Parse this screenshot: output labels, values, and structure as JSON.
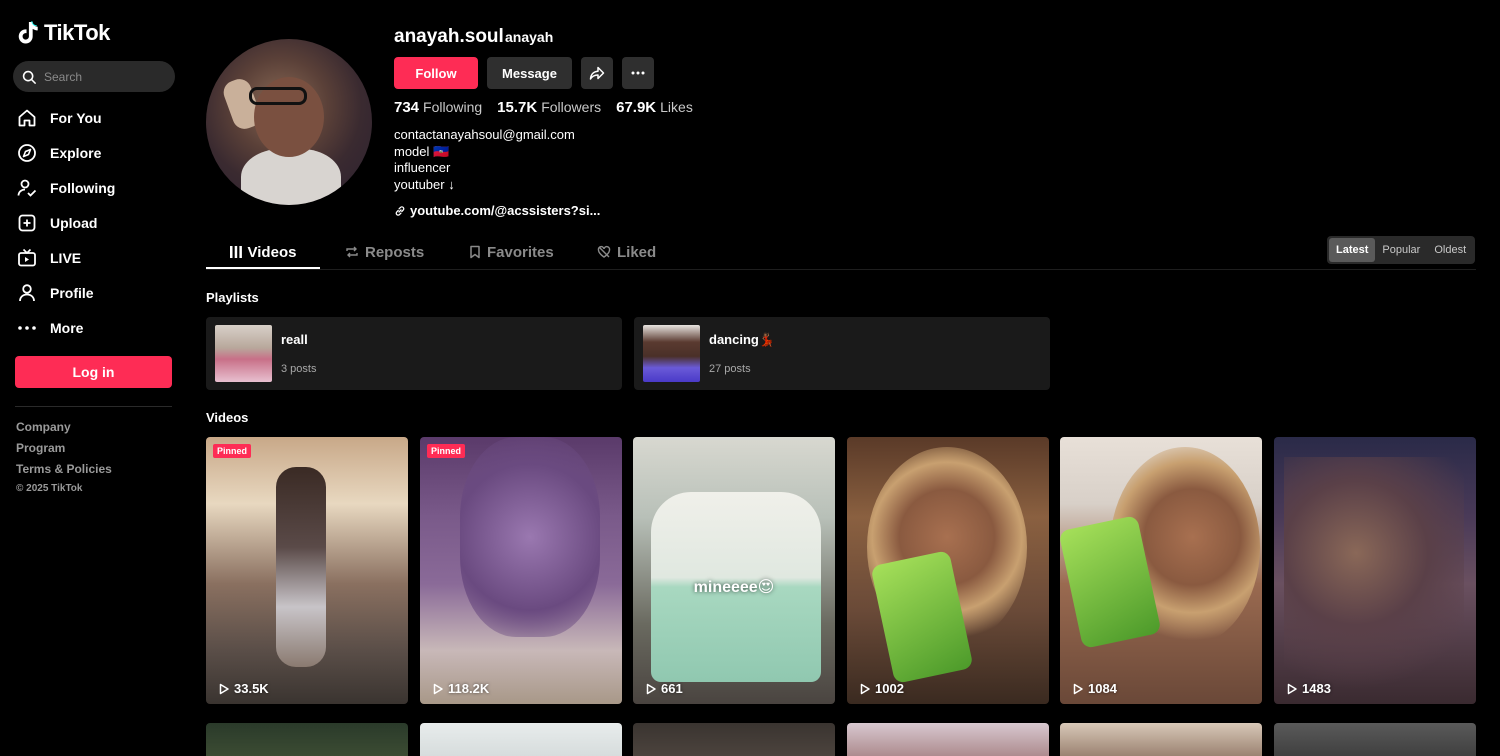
{
  "app": {
    "brand": "TikTok"
  },
  "sidebar": {
    "search_placeholder": "Search",
    "items": [
      {
        "label": "For You",
        "icon": "home-icon"
      },
      {
        "label": "Explore",
        "icon": "compass-icon"
      },
      {
        "label": "Following",
        "icon": "user-follow-icon"
      },
      {
        "label": "Upload",
        "icon": "plus-square-icon"
      },
      {
        "label": "LIVE",
        "icon": "live-tv-icon"
      },
      {
        "label": "Profile",
        "icon": "person-icon"
      },
      {
        "label": "More",
        "icon": "more-dots-icon"
      }
    ],
    "login_label": "Log in",
    "footer": {
      "links": [
        "Company",
        "Program",
        "Terms & Policies"
      ],
      "copyright": "© 2025 TikTok"
    }
  },
  "profile": {
    "username": "anayah.soul",
    "nickname": "anayah",
    "follow_label": "Follow",
    "message_label": "Message",
    "stats": [
      {
        "value": "734",
        "label": "Following"
      },
      {
        "value": "15.7K",
        "label": "Followers"
      },
      {
        "value": "67.9K",
        "label": "Likes"
      }
    ],
    "bio": [
      "contactanayahsoul@gmail.com",
      "model 🇭🇹",
      "influencer",
      "youtuber ↓"
    ],
    "link": "youtube.com/@acssisters?si..."
  },
  "tabs": [
    {
      "label": "Videos",
      "icon": "grid-icon",
      "active": true
    },
    {
      "label": "Reposts",
      "icon": "repost-icon",
      "active": false
    },
    {
      "label": "Favorites",
      "icon": "bookmark-icon",
      "active": false
    },
    {
      "label": "Liked",
      "icon": "heart-slash-icon",
      "active": false
    }
  ],
  "sort": {
    "options": [
      "Latest",
      "Popular",
      "Oldest"
    ],
    "selected": "Latest"
  },
  "playlists_title": "Playlists",
  "playlists": [
    {
      "name": "reall",
      "count": "3 posts"
    },
    {
      "name": "dancing💃🏾",
      "count": "27 posts"
    }
  ],
  "videos_title": "Videos",
  "videos": [
    {
      "views": "33.5K",
      "pinned": "Pinned",
      "caption": ""
    },
    {
      "views": "118.2K",
      "pinned": "Pinned",
      "caption": ""
    },
    {
      "views": "661",
      "pinned": "",
      "caption": "mineeee😍"
    },
    {
      "views": "1002",
      "pinned": "",
      "caption": ""
    },
    {
      "views": "1084",
      "pinned": "",
      "caption": ""
    },
    {
      "views": "1483",
      "pinned": "",
      "caption": ""
    }
  ],
  "colors": {
    "accent": "#fe2c55",
    "background": "#000000",
    "surface": "#1a1a1a"
  }
}
